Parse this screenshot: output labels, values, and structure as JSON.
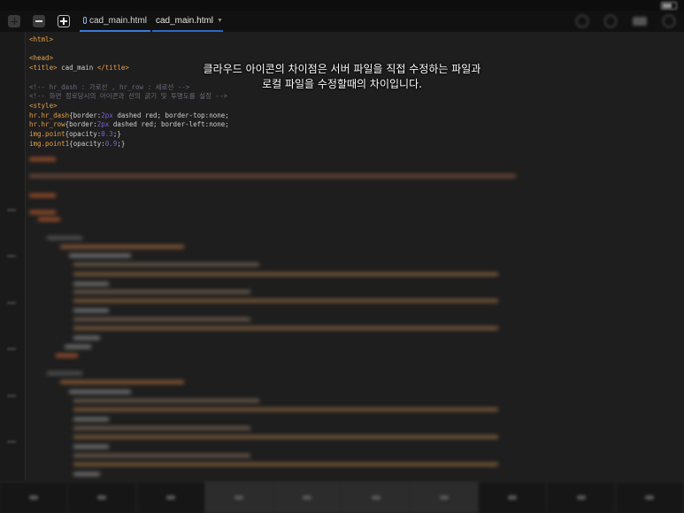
{
  "toolbar": {
    "tabs": [
      {
        "label": "cad_main.html",
        "cloud": true
      },
      {
        "label": "cad_main.html",
        "cloud": false
      }
    ]
  },
  "caption": {
    "line1": "클라우드 아이콘의 차이점은 서버 파일을 직접 수정하는 파일과",
    "line2": "로컬 파일을 수정할때의 차이입니다."
  },
  "code": {
    "l1": "<html>",
    "l2": "<head>",
    "l3a": "<title>",
    "l3b": " cad_main ",
    "l3c": "</title>",
    "c1": "<!-- hr_dash : 가로선 , hr_row : 세로선 -->",
    "c2": "<!-- 화면 정로당시의 아이콘과 선의 굵기 및 투명도를 설정 -->",
    "style_open": "<style>",
    "s1a": "hr.hr_dash",
    "s1b": "{border:",
    "s1c": "2px",
    "s1d": " dashed red; border-top:",
    "s1e": "none; ",
    "s2a": "hr.hr_row",
    "s2b": "{border:",
    "s2c": "2px",
    "s2d": " dashed red; border-left:",
    "s2e": "none; ",
    "s3a": "img.point",
    "s3b": "{opacity:",
    "s3c": "0.3",
    "s3d": ";}",
    "s4a": "img.point1",
    "s4b": "{opacity:",
    "s4c": "0.9",
    "s4d": ";}"
  },
  "colors": {
    "tag": "#e6a04a",
    "comment": "#6a6a7a",
    "number": "#7b61c9",
    "accent_tab": "#3a7bd5"
  },
  "icons": [
    "grid-icon",
    "minus-icon",
    "plus-icon",
    "cloud-icon"
  ]
}
